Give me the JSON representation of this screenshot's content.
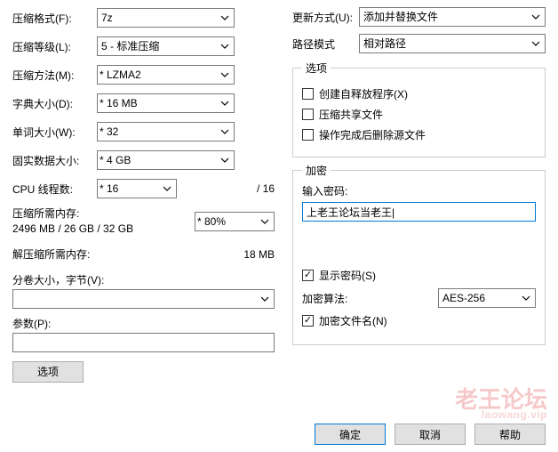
{
  "left": {
    "format": {
      "label": "压缩格式(F):",
      "value": "7z"
    },
    "level": {
      "label": "压缩等级(L):",
      "value": "5 - 标准压缩"
    },
    "method": {
      "label": "压缩方法(M):",
      "value": "* LZMA2"
    },
    "dict": {
      "label": "字典大小(D):",
      "value": "* 16 MB"
    },
    "word": {
      "label": "单词大小(W):",
      "value": "* 32"
    },
    "solid": {
      "label": "固实数据大小:",
      "value": "* 4 GB"
    },
    "threads": {
      "label": "CPU 线程数:",
      "value": "* 16",
      "total": "/ 16"
    },
    "mem_compress": {
      "label": "压缩所需内存:",
      "detail": "2496 MB / 26 GB / 32 GB",
      "pct": "* 80%"
    },
    "mem_decompress": {
      "label": "解压缩所需内存:",
      "value": "18 MB"
    },
    "split": {
      "label": "分卷大小，字节(V):",
      "value": ""
    },
    "params": {
      "label": "参数(P):",
      "value": ""
    },
    "options_btn": "选项"
  },
  "right": {
    "update": {
      "label": "更新方式(U):",
      "value": "添加并替换文件"
    },
    "path": {
      "label": "路径模式",
      "value": "相对路径"
    },
    "options_group": {
      "legend": "选项",
      "sfx": {
        "label": "创建自释放程序(X)",
        "checked": false
      },
      "share": {
        "label": "压缩共享文件",
        "checked": false
      },
      "delete": {
        "label": "操作完成后删除源文件",
        "checked": false
      }
    },
    "enc_group": {
      "legend": "加密",
      "pw_label": "输入密码:",
      "pw_value": "上老王论坛当老王|",
      "show_pw": {
        "label": "显示密码(S)",
        "checked": true
      },
      "algo": {
        "label": "加密算法:",
        "value": "AES-256"
      },
      "enc_names": {
        "label": "加密文件名(N)",
        "checked": true
      }
    }
  },
  "buttons": {
    "ok": "确定",
    "cancel": "取消",
    "help": "帮助"
  },
  "watermark": {
    "text": "老王论坛",
    "url": "laowang.vip"
  }
}
